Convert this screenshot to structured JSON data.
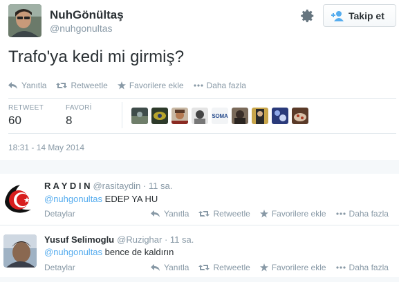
{
  "tweet": {
    "author_name": "NuhGönültaş",
    "author_handle": "@nuhgonultas",
    "follow_label": "Takip et",
    "text": "Trafo'ya kedi mi girmiş?",
    "actions": {
      "reply": "Yanıtla",
      "retweet": "Retweetle",
      "favorite": "Favorilere ekle",
      "more": "Daha fazla"
    },
    "stats": {
      "retweet_label": "RETWEET",
      "retweet_count": "60",
      "favorite_label": "FAVORİ",
      "favorite_count": "8"
    },
    "favoriter_faces": [
      "face-1",
      "face-2",
      "face-3",
      "face-4",
      "SOMA",
      "face-6",
      "face-7",
      "face-8",
      "face-9"
    ],
    "timestamp": "18:31 - 14 May 2014"
  },
  "replies": [
    {
      "name": "R A Y D I N",
      "handle": "@rasitaydin",
      "time": "· 11 sa.",
      "mention": "@nuhgonultas",
      "text": " EDEP YA HU",
      "details": "Detaylar",
      "actions": {
        "reply": "Yanıtla",
        "retweet": "Retweetle",
        "favorite": "Favorilere ekle",
        "more": "Daha fazla"
      }
    },
    {
      "name": "Yusuf Selimoglu",
      "handle": "@Ruzighar",
      "time": "· 11 sa.",
      "mention": "@nuhgonultas",
      "text": " bence de kaldırın",
      "details": "Detaylar",
      "actions": {
        "reply": "Yanıtla",
        "retweet": "Retweetle",
        "favorite": "Favorilere ekle",
        "more": "Daha fazla"
      }
    }
  ],
  "colors": {
    "text": "#292f33",
    "muted": "#8899a6",
    "link": "#55acee",
    "divider": "#e1e8ed"
  }
}
